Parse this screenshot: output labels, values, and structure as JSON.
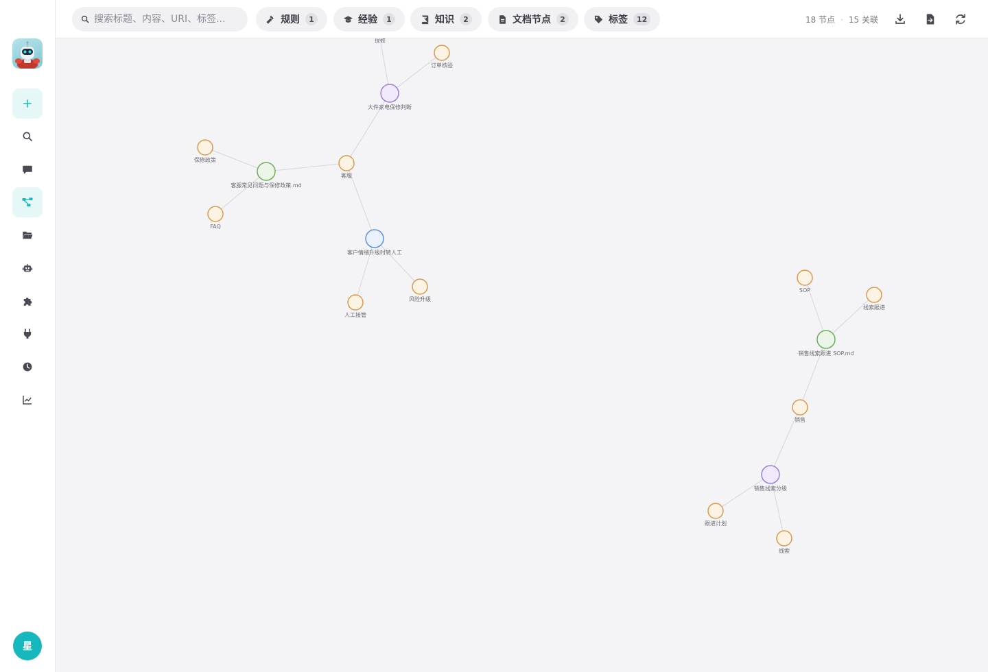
{
  "sidebar": {
    "items": [
      {
        "name": "new-button",
        "icon": "plus-icon"
      },
      {
        "name": "sidebar-item-search",
        "icon": "search-icon"
      },
      {
        "name": "sidebar-item-chat",
        "icon": "chat-icon"
      },
      {
        "name": "sidebar-item-graph",
        "icon": "graph-icon",
        "active": true
      },
      {
        "name": "sidebar-item-folders",
        "icon": "folder-open-icon"
      },
      {
        "name": "sidebar-item-agents",
        "icon": "robot-icon"
      },
      {
        "name": "sidebar-item-plugins",
        "icon": "puzzle-icon"
      },
      {
        "name": "sidebar-item-connectors",
        "icon": "plug-icon"
      },
      {
        "name": "sidebar-item-history",
        "icon": "clock-icon"
      },
      {
        "name": "sidebar-item-analytics",
        "icon": "chart-line-icon"
      }
    ],
    "avatar_initial": "星"
  },
  "toolbar": {
    "search_placeholder": "搜索标题、内容、URI、标签...",
    "filters": [
      {
        "label": "规则",
        "count": "1",
        "icon": "gavel-icon"
      },
      {
        "label": "经验",
        "count": "1",
        "icon": "graduation-cap-icon"
      },
      {
        "label": "知识",
        "count": "2",
        "icon": "book-icon"
      },
      {
        "label": "文档节点",
        "count": "2",
        "icon": "file-icon"
      },
      {
        "label": "标签",
        "count": "12",
        "icon": "tag-icon"
      }
    ],
    "node_count": "18 节点",
    "edge_count": "15 关联",
    "separator": "·",
    "actions": [
      "download-icon",
      "export-file-icon",
      "refresh-icon"
    ]
  },
  "colors": {
    "accent": "#17b8bd",
    "tag": "#d99a4e",
    "tag_fill": "#fdf3e4",
    "rule": "#9a7fd6",
    "rule_fill": "#f0eafc",
    "doc": "#6faa5c",
    "doc_fill": "#ebf6e8",
    "experience": "#5b8fe0",
    "experience_fill": "#eaf1fd",
    "edge": "#d4d4da"
  },
  "graph": {
    "nodes": [
      {
        "id": "baoxiu",
        "label": "保修",
        "type": "tag"
      },
      {
        "id": "dingdan",
        "label": "订单核验",
        "type": "tag"
      },
      {
        "id": "dajian",
        "label": "大件家电保修判断",
        "type": "rule"
      },
      {
        "id": "baoxiuzc",
        "label": "保修政策",
        "type": "tag"
      },
      {
        "id": "kefuwenti",
        "label": "客服常见问题与保修政策.md",
        "type": "doc"
      },
      {
        "id": "kefu",
        "label": "客服",
        "type": "tag"
      },
      {
        "id": "faq",
        "label": "FAQ",
        "type": "tag"
      },
      {
        "id": "kehu",
        "label": "客户情绪升级时转人工",
        "type": "experience"
      },
      {
        "id": "fengxian",
        "label": "风险升级",
        "type": "tag"
      },
      {
        "id": "rengong",
        "label": "人工接管",
        "type": "tag"
      },
      {
        "id": "sop",
        "label": "SOP",
        "type": "tag"
      },
      {
        "id": "xiansuogj",
        "label": "线索跟进",
        "type": "tag"
      },
      {
        "id": "xiaoshousop",
        "label": "销售线索跟进 SOP.md",
        "type": "doc"
      },
      {
        "id": "xiaoshou",
        "label": "销售",
        "type": "tag"
      },
      {
        "id": "xiaoshoufj",
        "label": "销售线索分级",
        "type": "rule"
      },
      {
        "id": "genjin",
        "label": "跟进计划",
        "type": "tag"
      },
      {
        "id": "xiansuo",
        "label": "线索",
        "type": "tag"
      }
    ],
    "edges": [
      [
        "baoxiu",
        "dajian"
      ],
      [
        "dingdan",
        "dajian"
      ],
      [
        "dajian",
        "kefu"
      ],
      [
        "baoxiuzc",
        "kefuwenti"
      ],
      [
        "kefuwenti",
        "kefu"
      ],
      [
        "faq",
        "kefuwenti"
      ],
      [
        "kefu",
        "kehu"
      ],
      [
        "kehu",
        "fengxian"
      ],
      [
        "kehu",
        "rengong"
      ],
      [
        "sop",
        "xiaoshousop"
      ],
      [
        "xiansuogj",
        "xiaoshousop"
      ],
      [
        "xiaoshousop",
        "xiaoshou"
      ],
      [
        "xiaoshou",
        "xiaoshoufj"
      ],
      [
        "xiaoshoufj",
        "genjin"
      ],
      [
        "xiaoshoufj",
        "xiansuo"
      ]
    ]
  }
}
